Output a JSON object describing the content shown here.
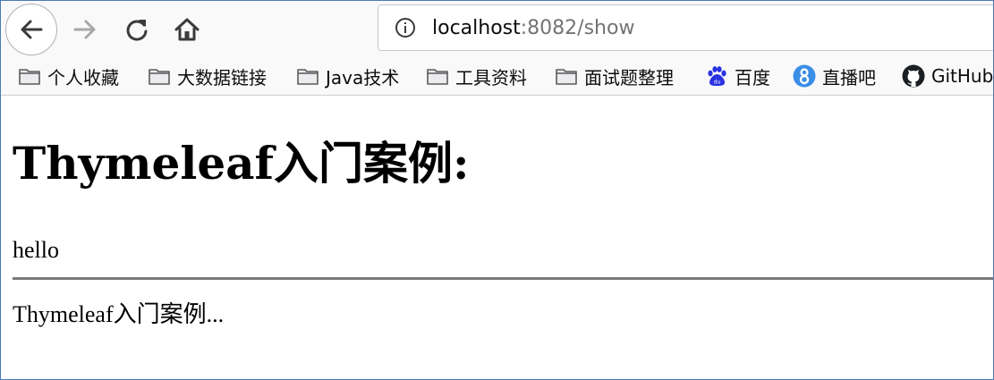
{
  "toolbar": {
    "url_host": "localhost",
    "url_rest": ":8082/show"
  },
  "bookmarks": [
    {
      "label": "个人收藏",
      "icon": "folder-icon"
    },
    {
      "label": "大数据链接",
      "icon": "folder-icon"
    },
    {
      "label": "Java技术",
      "icon": "folder-icon"
    },
    {
      "label": "工具资料",
      "icon": "folder-icon"
    },
    {
      "label": "面试题整理",
      "icon": "folder-icon"
    },
    {
      "label": "百度",
      "icon": "baidu-icon"
    },
    {
      "label": "直播吧",
      "icon": "zhibo8-icon"
    },
    {
      "label": "GitHub",
      "icon": "github-icon"
    }
  ],
  "page": {
    "title": "Thymeleaf入门案例:",
    "message": "hello",
    "footer": "Thymeleaf入门案例..."
  },
  "colors": {
    "baidu_blue": "#2932e1",
    "zhibo8_blue": "#3a8ee6",
    "divider": "#7a7a7a"
  }
}
